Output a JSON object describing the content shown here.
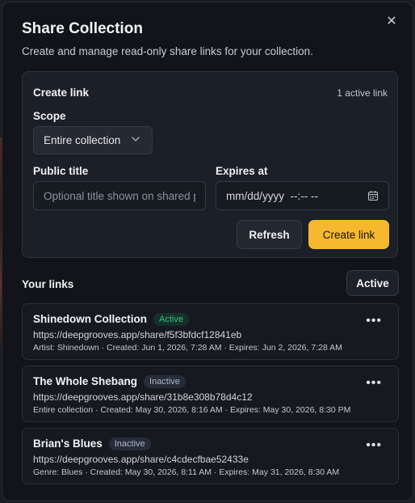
{
  "dialog": {
    "title": "Share Collection",
    "subtitle": "Create and manage read-only share links for your collection.",
    "close_icon": "close-icon"
  },
  "create": {
    "heading": "Create link",
    "active_count": "1 active link",
    "scope_label": "Scope",
    "scope_value": "Entire collection",
    "public_title_label": "Public title",
    "public_title_placeholder": "Optional title shown on shared page",
    "public_title_value": "",
    "expires_label": "Expires at",
    "expires_value": "mm/dd/yyyy  --:-- --",
    "refresh_label": "Refresh",
    "create_label": "Create link",
    "accent_color": "#f6b82e"
  },
  "links": {
    "heading": "Your links",
    "filter_label": "Active",
    "items": [
      {
        "name": "Shinedown Collection",
        "status": "Active",
        "url": "https://deepgrooves.app/share/f5f3bfdcf12841eb",
        "meta": "Artist: Shinedown · Created: Jun 1, 2026, 7:28 AM · Expires: Jun 2, 2026, 7:28 AM"
      },
      {
        "name": "The Whole Shebang",
        "status": "Inactive",
        "url": "https://deepgrooves.app/share/31b8e308b78d4c12",
        "meta": "Entire collection · Created: May 30, 2026, 8:16 AM · Expires: May 30, 2026, 8:30 PM"
      },
      {
        "name": "Brian's Blues",
        "status": "Inactive",
        "url": "https://deepgrooves.app/share/c4cdecfbae52433e",
        "meta": "Genre: Blues · Created: May 30, 2026, 8:11 AM · Expires: May 31, 2026, 8:30 AM"
      }
    ]
  }
}
